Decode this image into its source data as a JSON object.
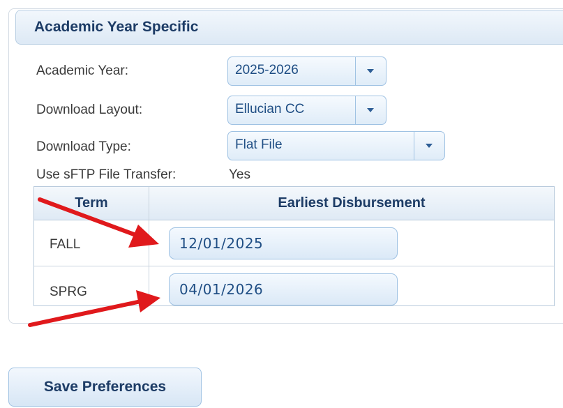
{
  "section": {
    "title": "Academic Year Specific"
  },
  "fields": {
    "academic_year": {
      "label": "Academic Year:",
      "value": "2025-2026"
    },
    "download_layout": {
      "label": "Download Layout:",
      "value": "Ellucian CC"
    },
    "download_type": {
      "label": "Download Type:",
      "value": "Flat File"
    },
    "sftp": {
      "label": "Use sFTP File Transfer:",
      "value": "Yes"
    }
  },
  "table": {
    "headers": [
      "Term",
      "Earliest Disbursement"
    ],
    "rows": [
      {
        "term": "FALL",
        "date": "12/01/2025"
      },
      {
        "term": "SPRG",
        "date": "04/01/2026"
      }
    ]
  },
  "actions": {
    "save_label": "Save Preferences"
  },
  "colors": {
    "accent": "#1d3c66",
    "input_text": "#1f4e84",
    "annotation_arrow": "#e0191c"
  }
}
